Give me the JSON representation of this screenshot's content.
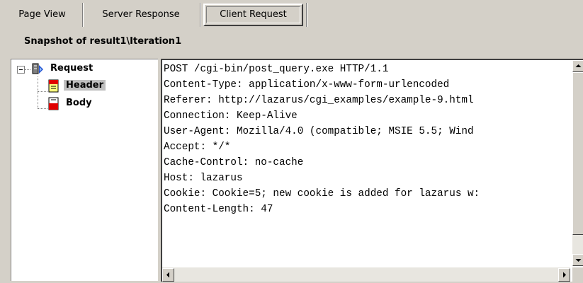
{
  "tabs": [
    {
      "label": "Page View",
      "active": false
    },
    {
      "label": "Server Response",
      "active": false
    },
    {
      "label": "Client Request",
      "active": true
    }
  ],
  "snapshot_title": "Snapshot of result1\\Iteration1",
  "tree": {
    "root": {
      "label": "Request",
      "icon": "request-icon",
      "expanded": true
    },
    "children": [
      {
        "label": "Header",
        "icon": "document-icon",
        "selected": true
      },
      {
        "label": "Body",
        "icon": "document-icon",
        "selected": false
      }
    ]
  },
  "request_lines": [
    "POST /cgi-bin/post_query.exe HTTP/1.1",
    "Content-Type: application/x-www-form-urlencoded",
    "Referer: http://lazarus/cgi_examples/example-9.html",
    "Connection: Keep-Alive",
    "User-Agent: Mozilla/4.0 (compatible; MSIE 5.5; Wind",
    "Accept: */*",
    "Cache-Control: no-cache",
    "Host: lazarus",
    "Cookie: Cookie=5; new cookie is added for lazarus w:",
    "Content-Length: 47"
  ],
  "colors": {
    "window_bg": "#d4d0c8",
    "panel_bg": "#ffffff",
    "selection_bg": "#c0c0c0",
    "icon_red": "#e00000",
    "icon_yellow": "#ffff80"
  }
}
